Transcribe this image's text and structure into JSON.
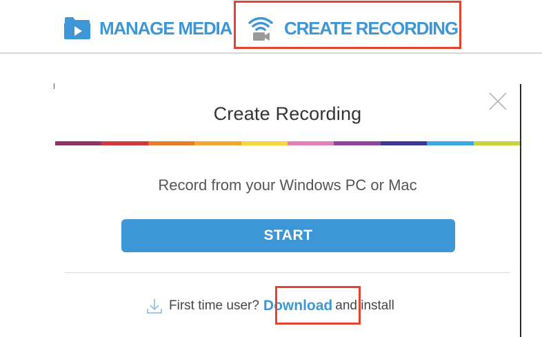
{
  "nav": {
    "manage_media": {
      "label": "MANAGE MEDIA",
      "icon": "folder-play-icon"
    },
    "create_recording": {
      "label": "CREATE RECORDING",
      "icon": "wifi-camera-icon"
    }
  },
  "dialog": {
    "title": "Create Recording",
    "close_icon": "close-icon",
    "subtitle": "Record from your Windows PC or Mac",
    "start_label": "START",
    "footer": {
      "prefix": "First time user?",
      "link": "Download",
      "suffix": "and install",
      "icon": "download-arrow-icon"
    }
  },
  "colors": {
    "accent": "#3d97d6",
    "highlight": "#e5432f",
    "rainbow": [
      "#8e3463",
      "#cf3a3c",
      "#e67c2d",
      "#f0a630",
      "#f2d63b",
      "#e37fb9",
      "#8e46a0",
      "#3c3791",
      "#3ba8e0",
      "#c7d33c"
    ]
  }
}
